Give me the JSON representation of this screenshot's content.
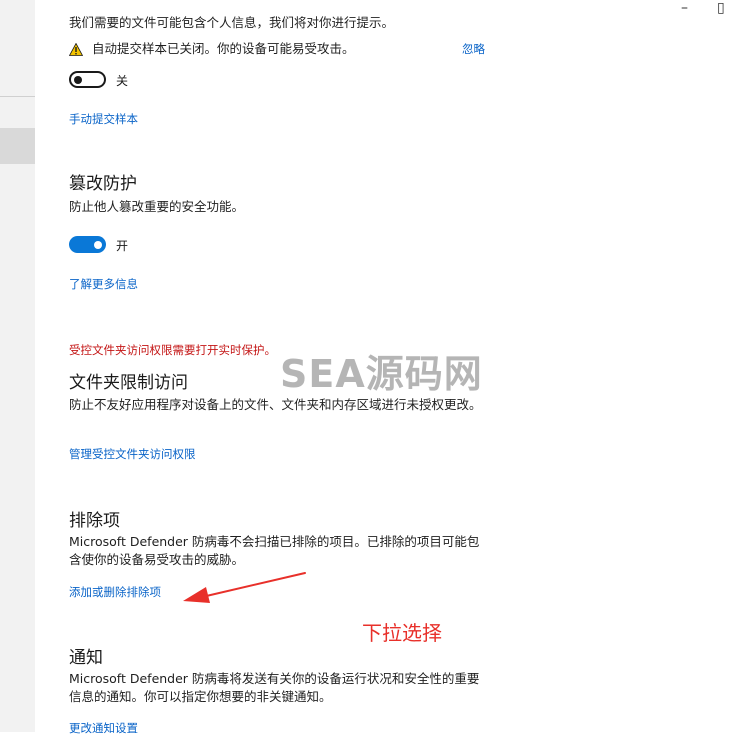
{
  "window": {
    "minimize_glyph": "–",
    "restore_glyph": "▯"
  },
  "sample_submission": {
    "description": "我们需要的文件可能包含个人信息，我们将对你进行提示。",
    "warning_text": "自动提交样本已关闭。你的设备可能易受攻击。",
    "dismiss_label": "忽略",
    "toggle_state_label": "关",
    "toggle_on": false,
    "manual_link": "手动提交样本"
  },
  "tamper_protection": {
    "heading": "篡改防护",
    "description": "防止他人篡改重要的安全功能。",
    "toggle_state_label": "开",
    "toggle_on": true,
    "learn_more_link": "了解更多信息"
  },
  "folder_access": {
    "error_text": "受控文件夹访问权限需要打开实时保护。",
    "heading": "文件夹限制访问",
    "description": "防止不友好应用程序对设备上的文件、文件夹和内存区域进行未授权更改。",
    "manage_link": "管理受控文件夹访问权限"
  },
  "exclusions": {
    "heading": "排除项",
    "description": "Microsoft Defender 防病毒不会扫描已排除的项目。已排除的项目可能包含使你的设备易受攻击的威胁。",
    "add_remove_link": "添加或删除排除项"
  },
  "notifications": {
    "heading": "通知",
    "description": "Microsoft Defender 防病毒将发送有关你的设备运行状况和安全性的重要信息的通知。你可以指定你想要的非关键通知。",
    "change_link": "更改通知设置"
  },
  "watermark_text": "SEA源码网",
  "annotation_text": "下拉选择",
  "colors": {
    "link": "#0a64c8",
    "toggle_on": "#0a78d7",
    "error": "#c41616",
    "annotation": "#e8302a",
    "warning_icon": "#f2c200"
  }
}
